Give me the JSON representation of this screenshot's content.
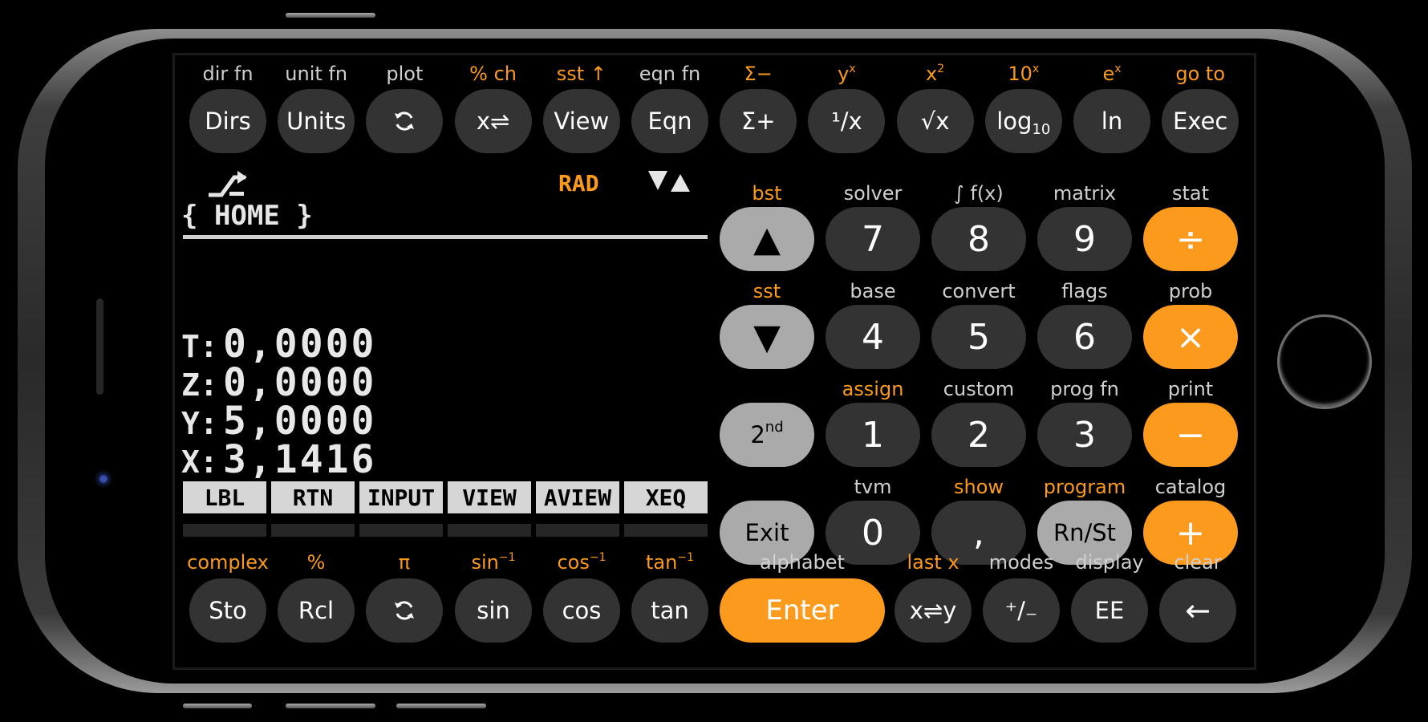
{
  "app": {
    "name": "Calculator"
  },
  "colors": {
    "accent": "#fb9a1c",
    "key_dark": "#333333",
    "key_gray": "#aaaaaa",
    "screen_bg": "#000000"
  },
  "display": {
    "shift_indicator_icon": "shift-arrow-icon",
    "angle_mode": "RAD",
    "updown_indicator_icon": "up-down-triangles-icon",
    "directory": "{ HOME }",
    "stack": [
      {
        "label": "T:",
        "value": "0,0000"
      },
      {
        "label": "Z:",
        "value": "0,0000"
      },
      {
        "label": "Y:",
        "value": "5,0000"
      },
      {
        "label": "X:",
        "value": "3,1416"
      }
    ],
    "menu": [
      "LBL",
      "RTN",
      "INPUT",
      "VIEW",
      "AVIEW",
      "XEQ"
    ]
  },
  "top_row": [
    {
      "shift": "dir fn",
      "shift_accent": false,
      "label": "Dirs"
    },
    {
      "shift": "unit fn",
      "shift_accent": false,
      "label": "Units"
    },
    {
      "shift": "plot",
      "shift_accent": false,
      "label": "",
      "icon": "rotate-arrows-icon"
    },
    {
      "shift": "% ch",
      "shift_accent": true,
      "label": "x⇌"
    },
    {
      "shift": "sst ↑",
      "shift_accent": true,
      "label": "View"
    },
    {
      "shift": "eqn fn",
      "shift_accent": false,
      "label": "Eqn"
    },
    {
      "shift": "Σ−",
      "shift_accent": true,
      "label": "Σ+"
    },
    {
      "shift": "y",
      "shift_sup": "x",
      "shift_accent": true,
      "label": "¹/x"
    },
    {
      "shift": "x",
      "shift_sup": "2",
      "shift_accent": true,
      "label": "√x"
    },
    {
      "shift": "10",
      "shift_sup": "x",
      "shift_accent": true,
      "label": "log",
      "label_sub": "10"
    },
    {
      "shift": "e",
      "shift_sup": "x",
      "shift_accent": true,
      "label": "ln"
    },
    {
      "shift": "go to",
      "shift_accent": true,
      "label": "Exec"
    }
  ],
  "keypad": {
    "rows": [
      [
        {
          "shift": "bst",
          "accent": true,
          "label": "▲",
          "style": "gray",
          "name": "up-arrow-key"
        },
        {
          "shift": "solver",
          "accent": false,
          "label": "7",
          "style": "dark",
          "name": "key-7"
        },
        {
          "shift": "∫ f(x)",
          "accent": false,
          "label": "8",
          "style": "dark",
          "name": "key-8"
        },
        {
          "shift": "matrix",
          "accent": false,
          "label": "9",
          "style": "dark",
          "name": "key-9"
        },
        {
          "shift": "stat",
          "accent": false,
          "label": "÷",
          "style": "orange",
          "name": "divide-key"
        }
      ],
      [
        {
          "shift": "sst",
          "accent": true,
          "label": "▼",
          "style": "gray",
          "name": "down-arrow-key"
        },
        {
          "shift": "base",
          "accent": false,
          "label": "4",
          "style": "dark",
          "name": "key-4"
        },
        {
          "shift": "convert",
          "accent": false,
          "label": "5",
          "style": "dark",
          "name": "key-5"
        },
        {
          "shift": "flags",
          "accent": false,
          "label": "6",
          "style": "dark",
          "name": "key-6"
        },
        {
          "shift": "prob",
          "accent": false,
          "label": "×",
          "style": "orange",
          "name": "multiply-key"
        }
      ],
      [
        {
          "shift": "",
          "accent": false,
          "label": "2",
          "label_sup": "nd",
          "style": "gray",
          "name": "second-key"
        },
        {
          "shift": "assign",
          "accent": true,
          "label": "1",
          "style": "dark",
          "name": "key-1"
        },
        {
          "shift": "custom",
          "accent": false,
          "label": "2",
          "style": "dark",
          "name": "key-2"
        },
        {
          "shift": "prog fn",
          "accent": false,
          "label": "3",
          "style": "dark",
          "name": "key-3"
        },
        {
          "shift": "print",
          "accent": false,
          "label": "−",
          "style": "orange",
          "name": "subtract-key"
        }
      ],
      [
        {
          "shift": "",
          "accent": false,
          "label": "Exit",
          "style": "gray",
          "name": "exit-key"
        },
        {
          "shift": "tvm",
          "accent": false,
          "label": "0",
          "style": "dark",
          "name": "key-0"
        },
        {
          "shift": "show",
          "accent": true,
          "label": ",",
          "style": "dark",
          "name": "decimal-key"
        },
        {
          "shift": "program",
          "accent": true,
          "label": "Rn/St",
          "style": "gray",
          "name": "run-stop-key"
        },
        {
          "shift": "catalog",
          "accent": false,
          "label": "+",
          "style": "orange",
          "name": "add-key"
        }
      ]
    ]
  },
  "bottom_row": [
    {
      "shift": "complex",
      "shift_accent": true,
      "label": "Sto"
    },
    {
      "shift": "%",
      "shift_accent": true,
      "label": "Rcl"
    },
    {
      "shift": "π",
      "shift_accent": true,
      "label": "",
      "icon": "rotate-arrows-icon"
    },
    {
      "shift": "sin",
      "shift_sup": "−1",
      "shift_accent": true,
      "label": "sin"
    },
    {
      "shift": "cos",
      "shift_sup": "−1",
      "shift_accent": true,
      "label": "cos"
    },
    {
      "shift": "tan",
      "shift_sup": "−1",
      "shift_accent": true,
      "label": "tan"
    },
    {
      "shift": "alphabet",
      "shift_accent": false,
      "label": "Enter"
    },
    {
      "shift": "last x",
      "shift_accent": true,
      "label": "x⇌y"
    },
    {
      "shift": "modes",
      "shift_accent": false,
      "label": "⁺/₋"
    },
    {
      "shift": "display",
      "shift_accent": false,
      "label": "EE"
    },
    {
      "shift": "clear",
      "shift_accent": false,
      "label": "←"
    }
  ]
}
